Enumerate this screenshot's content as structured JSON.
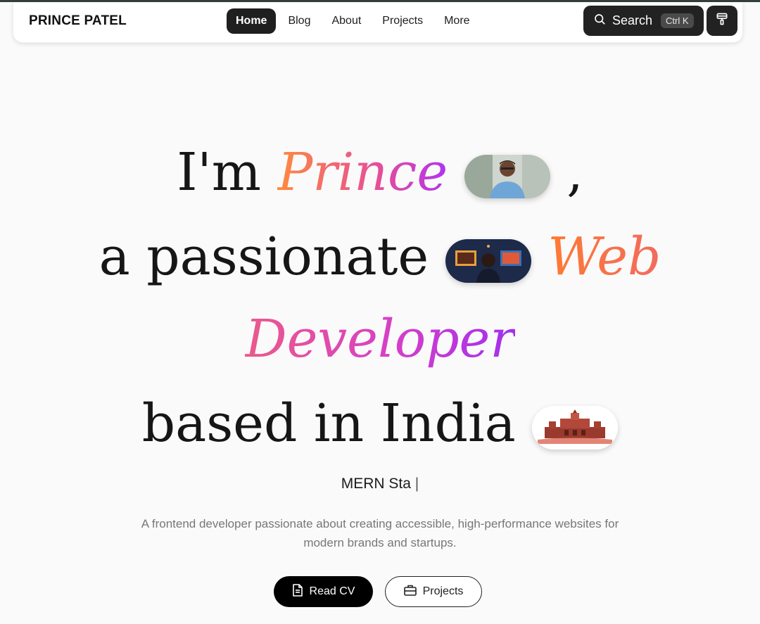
{
  "nav": {
    "brand": "PRINCE PATEL",
    "links": [
      {
        "label": "Home",
        "active": true
      },
      {
        "label": "Blog"
      },
      {
        "label": "About"
      },
      {
        "label": "Projects"
      },
      {
        "label": "More"
      }
    ],
    "search_label": "Search",
    "search_shortcut": "Ctrl K",
    "theme_icon": "paint-roller-icon"
  },
  "hero": {
    "line1_prefix": "I'm ",
    "line1_name": "Prince",
    "line1_suffix": ",",
    "line2_prefix": "a passionate",
    "line2_highlight": "Web",
    "line3_highlight": "Developer",
    "line4_text": "based in India",
    "typed_text": "MERN Sta",
    "typed_caret": "|",
    "description": "A frontend developer passionate about creating accessible, high-performance websites for modern brands and startups."
  },
  "buttons": {
    "read_cv": "Read CV",
    "projects": "Projects"
  },
  "colors": {
    "accent_orange": "#ff8a3d",
    "accent_pink": "#e64d9b",
    "accent_purple": "#b133f0",
    "dark": "#1f1f1f"
  }
}
